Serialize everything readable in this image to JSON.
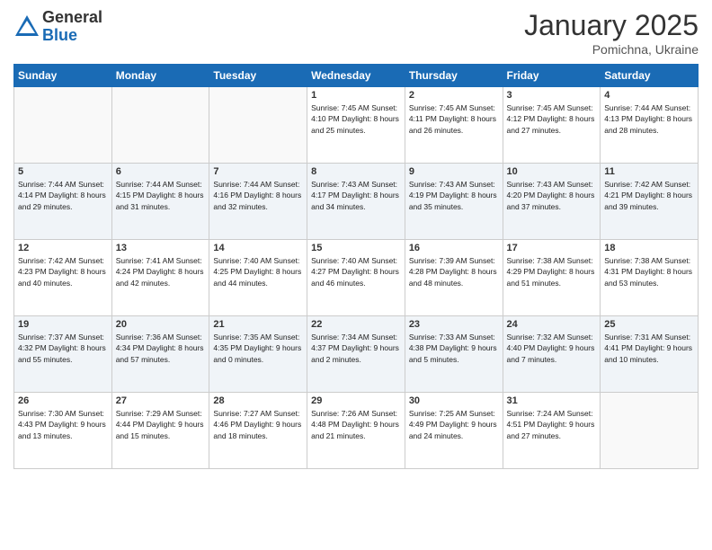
{
  "header": {
    "logo_general": "General",
    "logo_blue": "Blue",
    "month_title": "January 2025",
    "location": "Pomichna, Ukraine"
  },
  "days_of_week": [
    "Sunday",
    "Monday",
    "Tuesday",
    "Wednesday",
    "Thursday",
    "Friday",
    "Saturday"
  ],
  "weeks": [
    [
      {
        "day": "",
        "info": ""
      },
      {
        "day": "",
        "info": ""
      },
      {
        "day": "",
        "info": ""
      },
      {
        "day": "1",
        "info": "Sunrise: 7:45 AM\nSunset: 4:10 PM\nDaylight: 8 hours\nand 25 minutes."
      },
      {
        "day": "2",
        "info": "Sunrise: 7:45 AM\nSunset: 4:11 PM\nDaylight: 8 hours\nand 26 minutes."
      },
      {
        "day": "3",
        "info": "Sunrise: 7:45 AM\nSunset: 4:12 PM\nDaylight: 8 hours\nand 27 minutes."
      },
      {
        "day": "4",
        "info": "Sunrise: 7:44 AM\nSunset: 4:13 PM\nDaylight: 8 hours\nand 28 minutes."
      }
    ],
    [
      {
        "day": "5",
        "info": "Sunrise: 7:44 AM\nSunset: 4:14 PM\nDaylight: 8 hours\nand 29 minutes."
      },
      {
        "day": "6",
        "info": "Sunrise: 7:44 AM\nSunset: 4:15 PM\nDaylight: 8 hours\nand 31 minutes."
      },
      {
        "day": "7",
        "info": "Sunrise: 7:44 AM\nSunset: 4:16 PM\nDaylight: 8 hours\nand 32 minutes."
      },
      {
        "day": "8",
        "info": "Sunrise: 7:43 AM\nSunset: 4:17 PM\nDaylight: 8 hours\nand 34 minutes."
      },
      {
        "day": "9",
        "info": "Sunrise: 7:43 AM\nSunset: 4:19 PM\nDaylight: 8 hours\nand 35 minutes."
      },
      {
        "day": "10",
        "info": "Sunrise: 7:43 AM\nSunset: 4:20 PM\nDaylight: 8 hours\nand 37 minutes."
      },
      {
        "day": "11",
        "info": "Sunrise: 7:42 AM\nSunset: 4:21 PM\nDaylight: 8 hours\nand 39 minutes."
      }
    ],
    [
      {
        "day": "12",
        "info": "Sunrise: 7:42 AM\nSunset: 4:23 PM\nDaylight: 8 hours\nand 40 minutes."
      },
      {
        "day": "13",
        "info": "Sunrise: 7:41 AM\nSunset: 4:24 PM\nDaylight: 8 hours\nand 42 minutes."
      },
      {
        "day": "14",
        "info": "Sunrise: 7:40 AM\nSunset: 4:25 PM\nDaylight: 8 hours\nand 44 minutes."
      },
      {
        "day": "15",
        "info": "Sunrise: 7:40 AM\nSunset: 4:27 PM\nDaylight: 8 hours\nand 46 minutes."
      },
      {
        "day": "16",
        "info": "Sunrise: 7:39 AM\nSunset: 4:28 PM\nDaylight: 8 hours\nand 48 minutes."
      },
      {
        "day": "17",
        "info": "Sunrise: 7:38 AM\nSunset: 4:29 PM\nDaylight: 8 hours\nand 51 minutes."
      },
      {
        "day": "18",
        "info": "Sunrise: 7:38 AM\nSunset: 4:31 PM\nDaylight: 8 hours\nand 53 minutes."
      }
    ],
    [
      {
        "day": "19",
        "info": "Sunrise: 7:37 AM\nSunset: 4:32 PM\nDaylight: 8 hours\nand 55 minutes."
      },
      {
        "day": "20",
        "info": "Sunrise: 7:36 AM\nSunset: 4:34 PM\nDaylight: 8 hours\nand 57 minutes."
      },
      {
        "day": "21",
        "info": "Sunrise: 7:35 AM\nSunset: 4:35 PM\nDaylight: 9 hours\nand 0 minutes."
      },
      {
        "day": "22",
        "info": "Sunrise: 7:34 AM\nSunset: 4:37 PM\nDaylight: 9 hours\nand 2 minutes."
      },
      {
        "day": "23",
        "info": "Sunrise: 7:33 AM\nSunset: 4:38 PM\nDaylight: 9 hours\nand 5 minutes."
      },
      {
        "day": "24",
        "info": "Sunrise: 7:32 AM\nSunset: 4:40 PM\nDaylight: 9 hours\nand 7 minutes."
      },
      {
        "day": "25",
        "info": "Sunrise: 7:31 AM\nSunset: 4:41 PM\nDaylight: 9 hours\nand 10 minutes."
      }
    ],
    [
      {
        "day": "26",
        "info": "Sunrise: 7:30 AM\nSunset: 4:43 PM\nDaylight: 9 hours\nand 13 minutes."
      },
      {
        "day": "27",
        "info": "Sunrise: 7:29 AM\nSunset: 4:44 PM\nDaylight: 9 hours\nand 15 minutes."
      },
      {
        "day": "28",
        "info": "Sunrise: 7:27 AM\nSunset: 4:46 PM\nDaylight: 9 hours\nand 18 minutes."
      },
      {
        "day": "29",
        "info": "Sunrise: 7:26 AM\nSunset: 4:48 PM\nDaylight: 9 hours\nand 21 minutes."
      },
      {
        "day": "30",
        "info": "Sunrise: 7:25 AM\nSunset: 4:49 PM\nDaylight: 9 hours\nand 24 minutes."
      },
      {
        "day": "31",
        "info": "Sunrise: 7:24 AM\nSunset: 4:51 PM\nDaylight: 9 hours\nand 27 minutes."
      },
      {
        "day": "",
        "info": ""
      }
    ]
  ]
}
